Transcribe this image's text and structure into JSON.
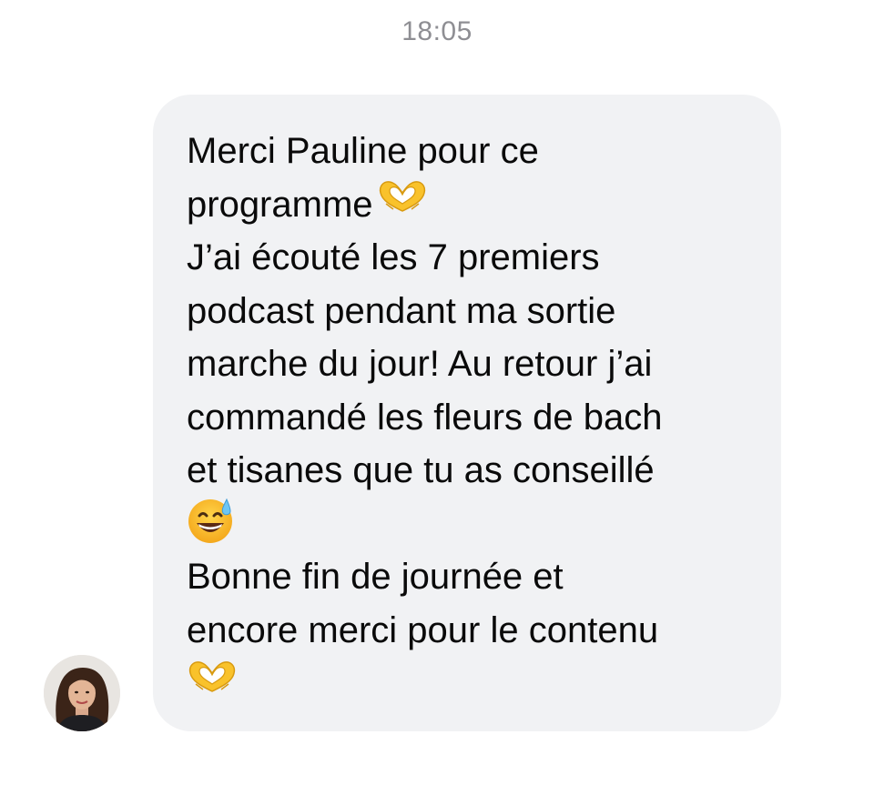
{
  "timestamp": "18:05",
  "sender": {
    "avatar_icon": "user-avatar-photo"
  },
  "message": {
    "lines": [
      "Merci Pauline pour ce",
      "programme",
      "J’ai écouté les 7 premiers",
      "podcast pendant ma sortie",
      "marche du jour! Au retour j’ai",
      "commandé les fleurs de bach",
      "et tisanes que tu as conseillé",
      "",
      "Bonne fin de journée et",
      "encore merci pour le contenu",
      ""
    ],
    "emojis": [
      "heart-hands-emoji",
      "grinning-sweat-emoji",
      "heart-hands-emoji"
    ]
  },
  "colors": {
    "bubble_background": "#f1f2f4",
    "text": "#0a0a0a",
    "timestamp": "#8e8e93"
  }
}
